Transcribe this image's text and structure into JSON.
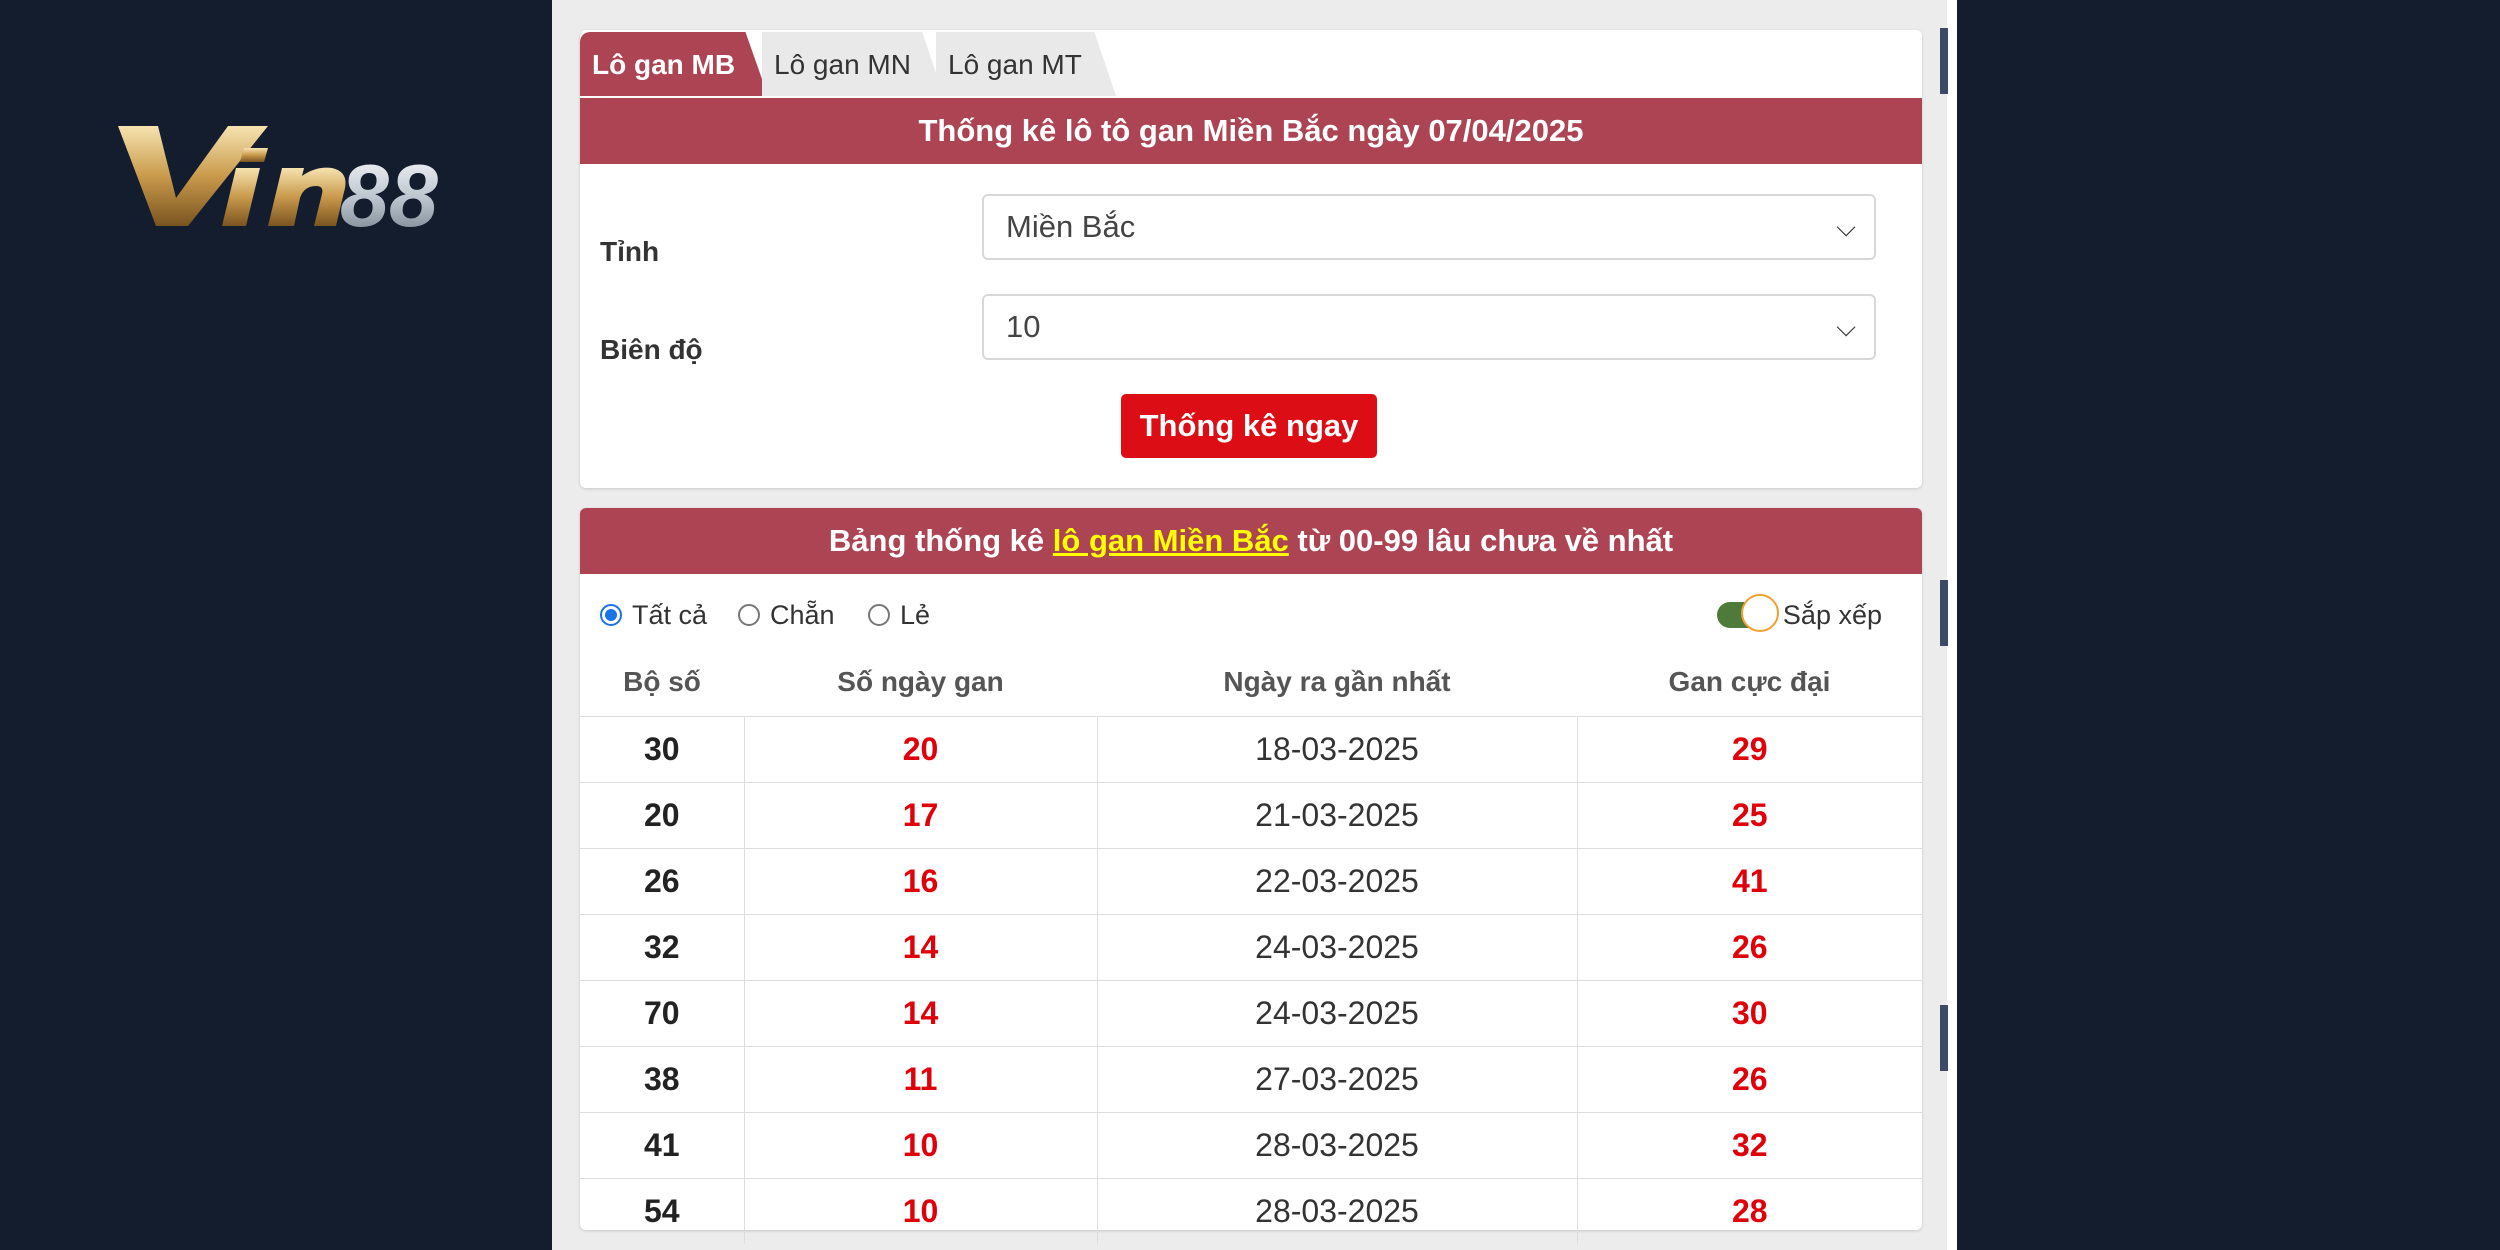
{
  "brand": {
    "logo_text": "Vin88",
    "accent": "#ad4453",
    "button_color": "#dd0d15",
    "bg": "#141d2e"
  },
  "tabs": [
    {
      "label": "Lô gan MB",
      "active": true
    },
    {
      "label": "Lô gan MN",
      "active": false
    },
    {
      "label": "Lô gan MT",
      "active": false
    }
  ],
  "form": {
    "title": "Thống kê lô tô gan Miền Bắc ngày 07/04/2025",
    "province_label": "Tỉnh",
    "province_value": "Miền Bắc",
    "range_label": "Biên độ",
    "range_value": "10",
    "submit_label": "Thống kê ngay"
  },
  "results": {
    "title_prefix": "Bảng thống kê",
    "title_link": "lô gan Miền Bắc",
    "title_suffix": "từ 00-99 lâu chưa về nhất",
    "filters": [
      {
        "label": "Tất cả",
        "selected": true
      },
      {
        "label": "Chẵn",
        "selected": false
      },
      {
        "label": "Lẻ",
        "selected": false
      }
    ],
    "sort_label": "Sắp xếp",
    "sort_on": true,
    "columns": [
      "Bộ số",
      "Số ngày gan",
      "Ngày ra gần nhất",
      "Gan cực đại"
    ],
    "rows": [
      {
        "number": "30",
        "days": "20",
        "last_date": "18-03-2025",
        "max_gan": "29"
      },
      {
        "number": "20",
        "days": "17",
        "last_date": "21-03-2025",
        "max_gan": "25"
      },
      {
        "number": "26",
        "days": "16",
        "last_date": "22-03-2025",
        "max_gan": "41"
      },
      {
        "number": "32",
        "days": "14",
        "last_date": "24-03-2025",
        "max_gan": "26"
      },
      {
        "number": "70",
        "days": "14",
        "last_date": "24-03-2025",
        "max_gan": "30"
      },
      {
        "number": "38",
        "days": "11",
        "last_date": "27-03-2025",
        "max_gan": "26"
      },
      {
        "number": "41",
        "days": "10",
        "last_date": "28-03-2025",
        "max_gan": "32"
      },
      {
        "number": "54",
        "days": "10",
        "last_date": "28-03-2025",
        "max_gan": "28"
      }
    ]
  }
}
